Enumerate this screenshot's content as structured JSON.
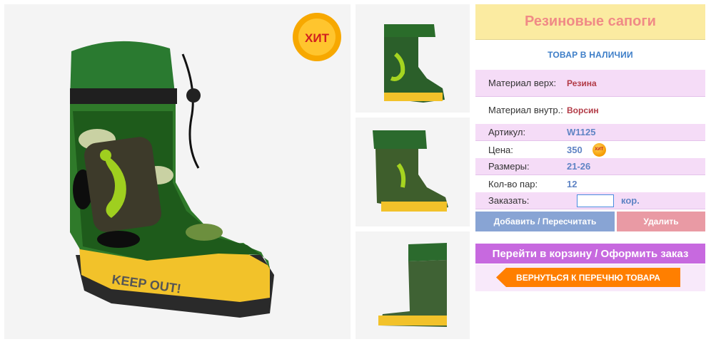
{
  "product": {
    "title": "Резиновые сапоги",
    "stock_status": "ТОВАР В НАЛИЧИИ",
    "hit_label": "ХИТ",
    "boot_print": "KEEP OUT!",
    "specs": [
      {
        "label": "Материал верх:",
        "value": "Резина"
      },
      {
        "label": "Материал внутр.:",
        "value": "Ворсин"
      },
      {
        "label": "Артикул:",
        "value": "W1125"
      },
      {
        "label": "Цена:",
        "value": "350"
      },
      {
        "label": "Размеры:",
        "value": "21-26"
      },
      {
        "label": "Кол-во пар:",
        "value": "12"
      }
    ],
    "order": {
      "label": "Заказать:",
      "value": "",
      "unit": "кор."
    }
  },
  "buttons": {
    "add": "Добавить / Пересчитать",
    "delete": "Удалить",
    "cart": "Перейти в корзину / Оформить заказ",
    "back": "ВЕРНУТЬСЯ К ПЕРЕЧНЮ ТОВАРА"
  },
  "colors": {
    "title_bg": "#fbeba1",
    "title_text": "#f08a86",
    "row_pink": "#f5dcf7",
    "accent_blue": "#5f84c4",
    "value_red": "#b23b47",
    "cart_purple": "#c769df",
    "back_orange": "#ff7f00"
  }
}
